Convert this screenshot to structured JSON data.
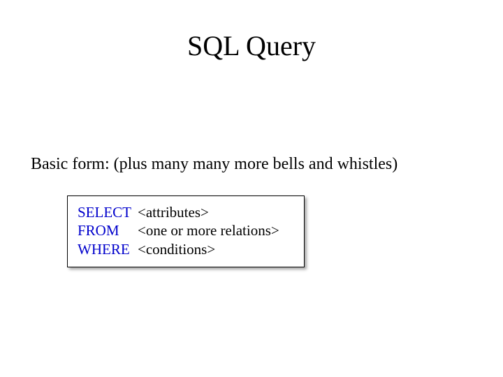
{
  "title": "SQL Query",
  "subtitle": "Basic form: (plus many many more bells and whistles)",
  "code": {
    "line1": {
      "keyword": "SELECT",
      "placeholder": "<attributes>"
    },
    "line2": {
      "keyword": "FROM",
      "placeholder": "<one or more relations>"
    },
    "line3": {
      "keyword": "WHERE",
      "placeholder": "<conditions>"
    }
  }
}
